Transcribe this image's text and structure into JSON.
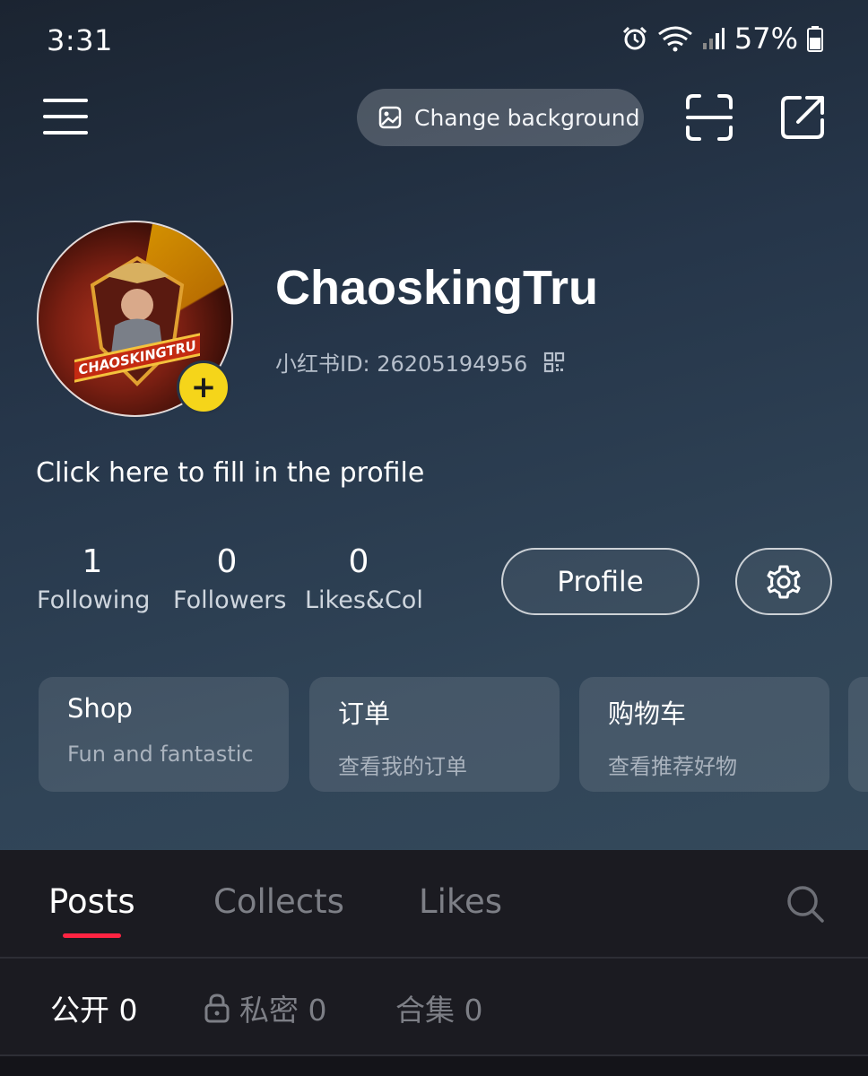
{
  "status_bar": {
    "time": "3:31",
    "battery": "57%",
    "icons": [
      "alarm-icon",
      "wifi-icon",
      "signal-icon",
      "battery-icon"
    ]
  },
  "top_bar": {
    "change_background_label": "Change background",
    "icons": [
      "menu-icon",
      "image-icon",
      "scan-icon",
      "share-icon"
    ]
  },
  "profile": {
    "username": "ChaoskingTru",
    "id_label": "小红书ID: 26205194956",
    "bio_placeholder": "Click here to fill in the profile",
    "avatar_text": "CHAOSKINGTRU"
  },
  "stats": [
    {
      "value": "1",
      "label": "Following"
    },
    {
      "value": "0",
      "label": "Followers"
    },
    {
      "value": "0",
      "label": "Likes&Col"
    }
  ],
  "actions": {
    "profile_label": "Profile",
    "settings_icon": "gear-icon"
  },
  "cards": [
    {
      "title": "Shop",
      "subtitle": "Fun and fantastic"
    },
    {
      "title": "订单",
      "subtitle": "查看我的订单"
    },
    {
      "title": "购物车",
      "subtitle": "查看推荐好物"
    }
  ],
  "content_tabs": {
    "tabs": [
      "Posts",
      "Collects",
      "Likes"
    ],
    "active": "Posts"
  },
  "sub_tabs": [
    {
      "label": "公开 0"
    },
    {
      "label": "私密 0",
      "icon": "lock-icon"
    },
    {
      "label": "合集 0"
    }
  ],
  "colors": {
    "accent": "#ff2442",
    "add_badge": "#f5d51a",
    "background_dark": "#1b1b21"
  }
}
